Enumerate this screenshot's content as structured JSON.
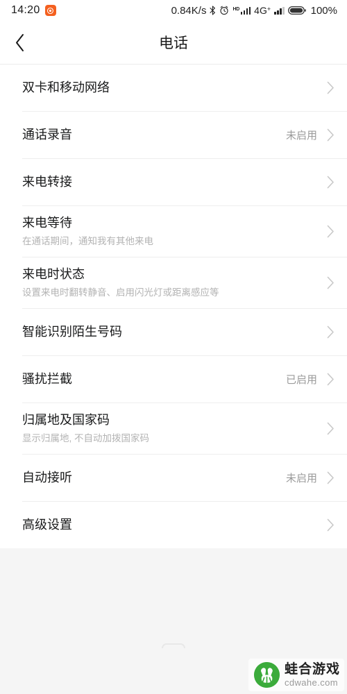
{
  "status_bar": {
    "time": "14:20",
    "notification_icon": "app-notification-icon",
    "network_speed": "0.84K/s",
    "bluetooth_icon": "bluetooth-icon",
    "alarm_icon": "alarm-clock-icon",
    "hd_label": "HD",
    "sim1_signal_icon": "signal-bars-icon",
    "network_type": "4G",
    "network_type_sup": "+",
    "sim2_signal_icon": "signal-bars-icon",
    "battery_icon": "battery-full-icon",
    "battery_percent": "100%"
  },
  "titlebar": {
    "back_icon": "back-chevron-icon",
    "title": "电话"
  },
  "settings": {
    "items": [
      {
        "title": "双卡和移动网络",
        "subtitle": "",
        "value": ""
      },
      {
        "title": "通话录音",
        "subtitle": "",
        "value": "未启用"
      },
      {
        "title": "来电转接",
        "subtitle": "",
        "value": ""
      },
      {
        "title": "来电等待",
        "subtitle": "在通话期间，通知我有其他来电",
        "value": ""
      },
      {
        "title": "来电时状态",
        "subtitle": "设置来电时翻转静音、启用闪光灯或距离感应等",
        "value": ""
      },
      {
        "title": "智能识别陌生号码",
        "subtitle": "",
        "value": ""
      },
      {
        "title": "骚扰拦截",
        "subtitle": "",
        "value": "已启用"
      },
      {
        "title": "归属地及国家码",
        "subtitle": "显示归属地, 不自动加拨国家码",
        "value": ""
      },
      {
        "title": "自动接听",
        "subtitle": "",
        "value": "未启用"
      },
      {
        "title": "高级设置",
        "subtitle": "",
        "value": ""
      }
    ],
    "chevron_icon": "chevron-right-icon"
  },
  "watermark": {
    "logo_icon": "frog-logo-icon",
    "name": "蛙合游戏",
    "url": "cdwahe.com"
  },
  "colors": {
    "page_bg": "#f5f5f5",
    "card_bg": "#ffffff",
    "title_text": "#18191a",
    "sub_text": "#b3b3b3",
    "value_text": "#9a9a9a",
    "divider": "#eeeeee",
    "accent_orange": "#f4601f",
    "logo_green": "#3bab3b"
  }
}
